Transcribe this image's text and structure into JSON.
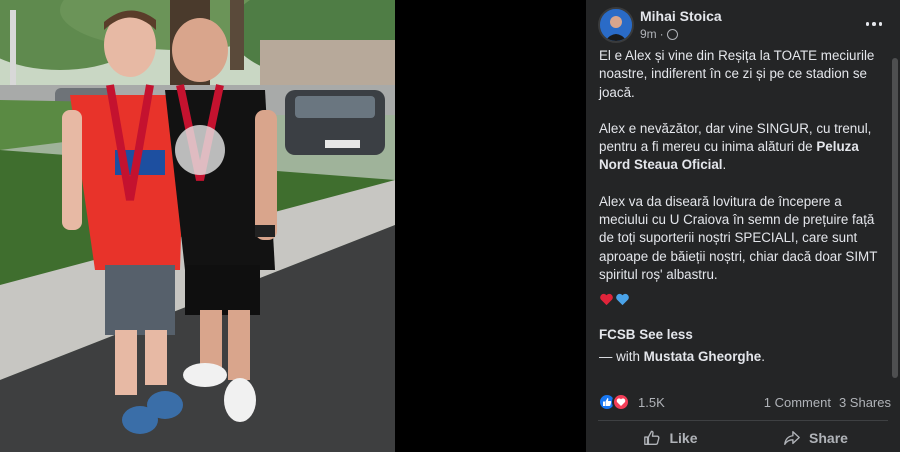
{
  "post": {
    "author": "Mihai Stoica",
    "time": "9m",
    "time_separator": "·",
    "menu_icon": "more-horizontal-icon",
    "privacy_icon": "globe-icon",
    "paragraphs": {
      "p1": "El e Alex și vine din Reșița la TOATE meciurile noastre, indiferent în ce zi și pe ce stadion se joacă.",
      "p2_before": "Alex e nevăzător, dar vine SINGUR, cu trenul, pentru a fi mereu cu inima alături de ",
      "p2_bold": "Peluza Nord Steaua Oficial",
      "p2_after": ".",
      "p3": "Alex va da diseară lovitura de începere a meciului cu U Craiova în semn de prețuire față de toți suporterii noștri SPECIALI, care sunt aproape de băieții noștri, chiar dacă doar SIMT spiritul roș' albastru."
    },
    "hearts": [
      "red-heart-icon",
      "blue-heart-icon"
    ],
    "tag": "FCSB",
    "see_less": "See less",
    "with_prefix": "— with ",
    "with_name": "Mustata Gheorghe",
    "with_suffix": "."
  },
  "stats": {
    "reaction_icons": [
      "like-reaction-icon",
      "love-reaction-icon"
    ],
    "reaction_count": "1.5K",
    "comments": "1 Comment",
    "shares": "3 Shares"
  },
  "actions": {
    "like_label": "Like",
    "share_label": "Share"
  },
  "colors": {
    "panel_bg": "#242526",
    "text": "#e4e6eb",
    "secondary_text": "#b0b3b8",
    "like_blue": "#1877f2",
    "love_red": "#f33e58"
  }
}
